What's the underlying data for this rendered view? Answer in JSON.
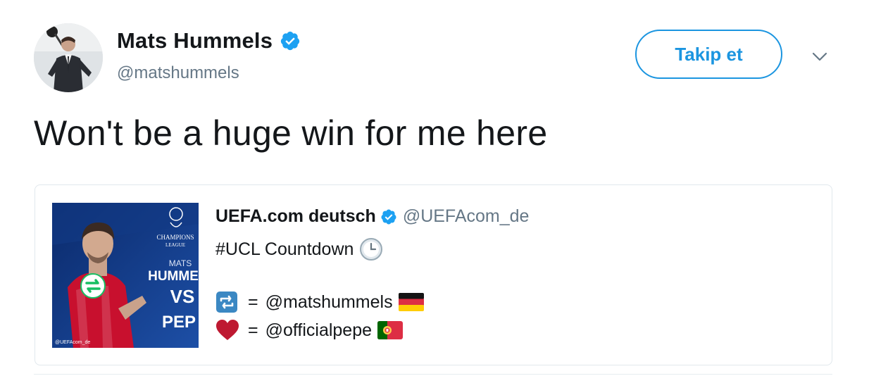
{
  "tweet": {
    "author": {
      "display_name": "Mats Hummels",
      "handle": "@matshummels",
      "verified": true,
      "avatar_icon": "profile-photo"
    },
    "follow_button_label": "Takip et",
    "menu_icon": "chevron-down-icon",
    "text": "Won't be a huge win for me here"
  },
  "quoted_tweet": {
    "author": {
      "display_name": "UEFA.com deutsch",
      "handle": "@UEFAcom_de",
      "verified": true
    },
    "line1_text": "#UCL Countdown",
    "line1_emoji": "clock-icon",
    "line2": {
      "prefix": "=",
      "text": "@matshummels",
      "lead_icon": "retweet-emoji-icon",
      "flag": "germany-flag-icon"
    },
    "line3": {
      "prefix": "=",
      "text": "@officialpepe",
      "lead_icon": "heart-emoji-icon",
      "flag": "portugal-flag-icon"
    },
    "image": {
      "overlay_lines": [
        "CHAMPIONS",
        "LEAGUE",
        "MATS",
        "HUMME",
        "VS",
        "PEP"
      ],
      "watermark": "@UEFAcom_de"
    }
  },
  "colors": {
    "brand_blue": "#1b95e0",
    "text_primary": "#14171a",
    "text_secondary": "#657786",
    "border": "#e1e8ed",
    "heart_red": "#be1931",
    "retweet_green": "#17bf63"
  }
}
